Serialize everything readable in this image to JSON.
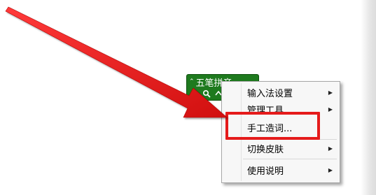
{
  "ime_toolbar": {
    "title": "五笔拼音",
    "tool_icons": [
      "hand-icon",
      "search-icon",
      "chevron-up-icon"
    ],
    "color": "#1e7a1e"
  },
  "context_menu": {
    "items": [
      {
        "label": "输入法设置",
        "has_submenu": true
      },
      {
        "label": "管理工具",
        "has_submenu": true
      },
      {
        "label": "手工造词...",
        "has_submenu": false
      },
      {
        "label": "切换皮肤",
        "has_submenu": true
      },
      {
        "label": "使用说明",
        "has_submenu": true
      }
    ]
  },
  "annotation": {
    "arrow_color": "#e51b1b",
    "highlight_color": "#e51b1b",
    "highlighted_item": "手工造词..."
  }
}
